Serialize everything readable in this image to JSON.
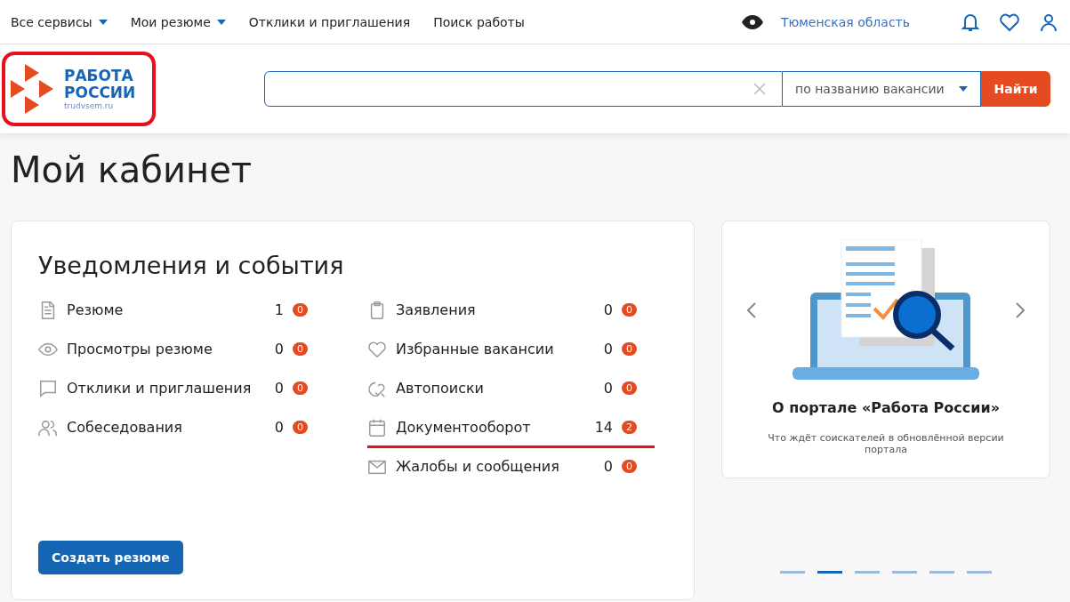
{
  "top_nav": {
    "items": [
      {
        "label": "Все сервисы",
        "dropdown": true
      },
      {
        "label": "Мои резюме",
        "dropdown": true
      },
      {
        "label": "Отклики и приглашения",
        "dropdown": false
      },
      {
        "label": "Поиск работы",
        "dropdown": false
      }
    ],
    "region": "Тюменская область"
  },
  "header": {
    "logo": {
      "line1": "РАБОТА",
      "line2": "РОССИИ",
      "domain": "trudvsem.ru",
      "highlighted": true
    },
    "search": {
      "mode": "по названию вакансии",
      "button": "Найти"
    }
  },
  "page_title": "Мой кабинет",
  "notifications": {
    "title": "Уведомления и события",
    "columns": [
      [
        {
          "kind": "document",
          "label": "Резюме",
          "count": "1",
          "badge": "0",
          "underlined": false
        },
        {
          "kind": "eye",
          "label": "Просмотры резюме",
          "count": "0",
          "badge": "0",
          "underlined": false
        },
        {
          "kind": "chat",
          "label": "Отклики и приглашения",
          "count": "0",
          "badge": "0",
          "underlined": false
        },
        {
          "kind": "people",
          "label": "Собеседования",
          "count": "0",
          "badge": "0",
          "underlined": false
        }
      ],
      [
        {
          "kind": "clipboard",
          "label": "Заявления",
          "count": "0",
          "badge": "0",
          "underlined": false
        },
        {
          "kind": "heart",
          "label": "Избранные вакансии",
          "count": "0",
          "badge": "0",
          "underlined": false
        },
        {
          "kind": "heart-search",
          "label": "Автопоиски",
          "count": "0",
          "badge": "0",
          "underlined": false
        },
        {
          "kind": "calendar",
          "label": "Документооборот",
          "count": "14",
          "badge": "2",
          "underlined": true
        },
        {
          "kind": "mail",
          "label": "Жалобы и сообщения",
          "count": "0",
          "badge": "0",
          "underlined": false
        }
      ]
    ],
    "button": "Создать резюме"
  },
  "promo": {
    "title": "О портале «Работа России»",
    "text": "Что ждёт соискателей в обновлённой версии портала",
    "dots": [
      {
        "selected": false
      },
      {
        "selected": true
      },
      {
        "selected": false
      },
      {
        "selected": false
      },
      {
        "selected": false
      },
      {
        "selected": false
      }
    ]
  }
}
